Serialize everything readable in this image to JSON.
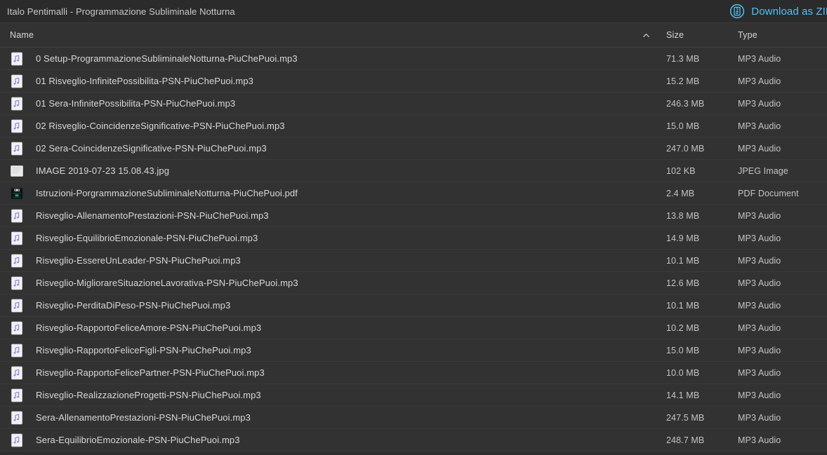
{
  "window": {
    "title": "Italo Pentimalli - Programmazione Subliminale Notturna"
  },
  "toolbar": {
    "download_zip_label": "Download as ZIP",
    "download_zip_icon": "zip-archive-circle-icon",
    "accent_color": "#4fc3f7"
  },
  "table": {
    "columns": {
      "name": "Name",
      "size": "Size",
      "type": "Type"
    },
    "sort": {
      "column": "name",
      "direction": "ascending",
      "icon": "caret-up-icon"
    },
    "rows": [
      {
        "icon": "mp3-file-icon",
        "name": "0 Setup-ProgrammazioneSubliminaleNotturna-PiuChePuoi.mp3",
        "size": "71.3 MB",
        "type": "MP3 Audio"
      },
      {
        "icon": "mp3-file-icon",
        "name": "01 Risveglio-InfinitePossibilita-PSN-PiuChePuoi.mp3",
        "size": "15.2 MB",
        "type": "MP3 Audio"
      },
      {
        "icon": "mp3-file-icon",
        "name": "01 Sera-InfinitePossibilita-PSN-PiuChePuoi.mp3",
        "size": "246.3 MB",
        "type": "MP3 Audio"
      },
      {
        "icon": "mp3-file-icon",
        "name": "02 Risveglio-CoincidenzeSignificative-PSN-PiuChePuoi.mp3",
        "size": "15.0 MB",
        "type": "MP3 Audio"
      },
      {
        "icon": "mp3-file-icon",
        "name": "02 Sera-CoincidenzeSignificative-PSN-PiuChePuoi.mp3",
        "size": "247.0 MB",
        "type": "MP3 Audio"
      },
      {
        "icon": "jpeg-file-icon",
        "name": "IMAGE 2019-07-23 15.08.43.jpg",
        "size": "102 KB",
        "type": "JPEG Image"
      },
      {
        "icon": "pdf-file-icon",
        "name": "Istruzioni-PorgrammazioneSubliminaleNotturna-PiuChePuoi.pdf",
        "size": "2.4 MB",
        "type": "PDF Document"
      },
      {
        "icon": "mp3-file-icon",
        "name": "Risveglio-AllenamentoPrestazioni-PSN-PiuChePuoi.mp3",
        "size": "13.8 MB",
        "type": "MP3 Audio"
      },
      {
        "icon": "mp3-file-icon",
        "name": "Risveglio-EquilibrioEmozionale-PSN-PiuChePuoi.mp3",
        "size": "14.9 MB",
        "type": "MP3 Audio"
      },
      {
        "icon": "mp3-file-icon",
        "name": "Risveglio-EssereUnLeader-PSN-PiuChePuoi.mp3",
        "size": "10.1 MB",
        "type": "MP3 Audio"
      },
      {
        "icon": "mp3-file-icon",
        "name": "Risveglio-MigliorareSituazioneLavorativa-PSN-PiuChePuoi.mp3",
        "size": "12.6 MB",
        "type": "MP3 Audio"
      },
      {
        "icon": "mp3-file-icon",
        "name": "Risveglio-PerditaDiPeso-PSN-PiuChePuoi.mp3",
        "size": "10.1 MB",
        "type": "MP3 Audio"
      },
      {
        "icon": "mp3-file-icon",
        "name": "Risveglio-RapportoFeliceAmore-PSN-PiuChePuoi.mp3",
        "size": "10.2 MB",
        "type": "MP3 Audio"
      },
      {
        "icon": "mp3-file-icon",
        "name": "Risveglio-RapportoFeliceFigli-PSN-PiuChePuoi.mp3",
        "size": "15.0 MB",
        "type": "MP3 Audio"
      },
      {
        "icon": "mp3-file-icon",
        "name": "Risveglio-RapportoFelicePartner-PSN-PiuChePuoi.mp3",
        "size": "10.0 MB",
        "type": "MP3 Audio"
      },
      {
        "icon": "mp3-file-icon",
        "name": "Risveglio-RealizzazioneProgetti-PSN-PiuChePuoi.mp3",
        "size": "14.1 MB",
        "type": "MP3 Audio"
      },
      {
        "icon": "mp3-file-icon",
        "name": "Sera-AllenamentoPrestazioni-PSN-PiuChePuoi.mp3",
        "size": "247.5 MB",
        "type": "MP3 Audio"
      },
      {
        "icon": "mp3-file-icon",
        "name": "Sera-EquilibrioEmozionale-PSN-PiuChePuoi.mp3",
        "size": "248.7 MB",
        "type": "MP3 Audio"
      }
    ]
  }
}
